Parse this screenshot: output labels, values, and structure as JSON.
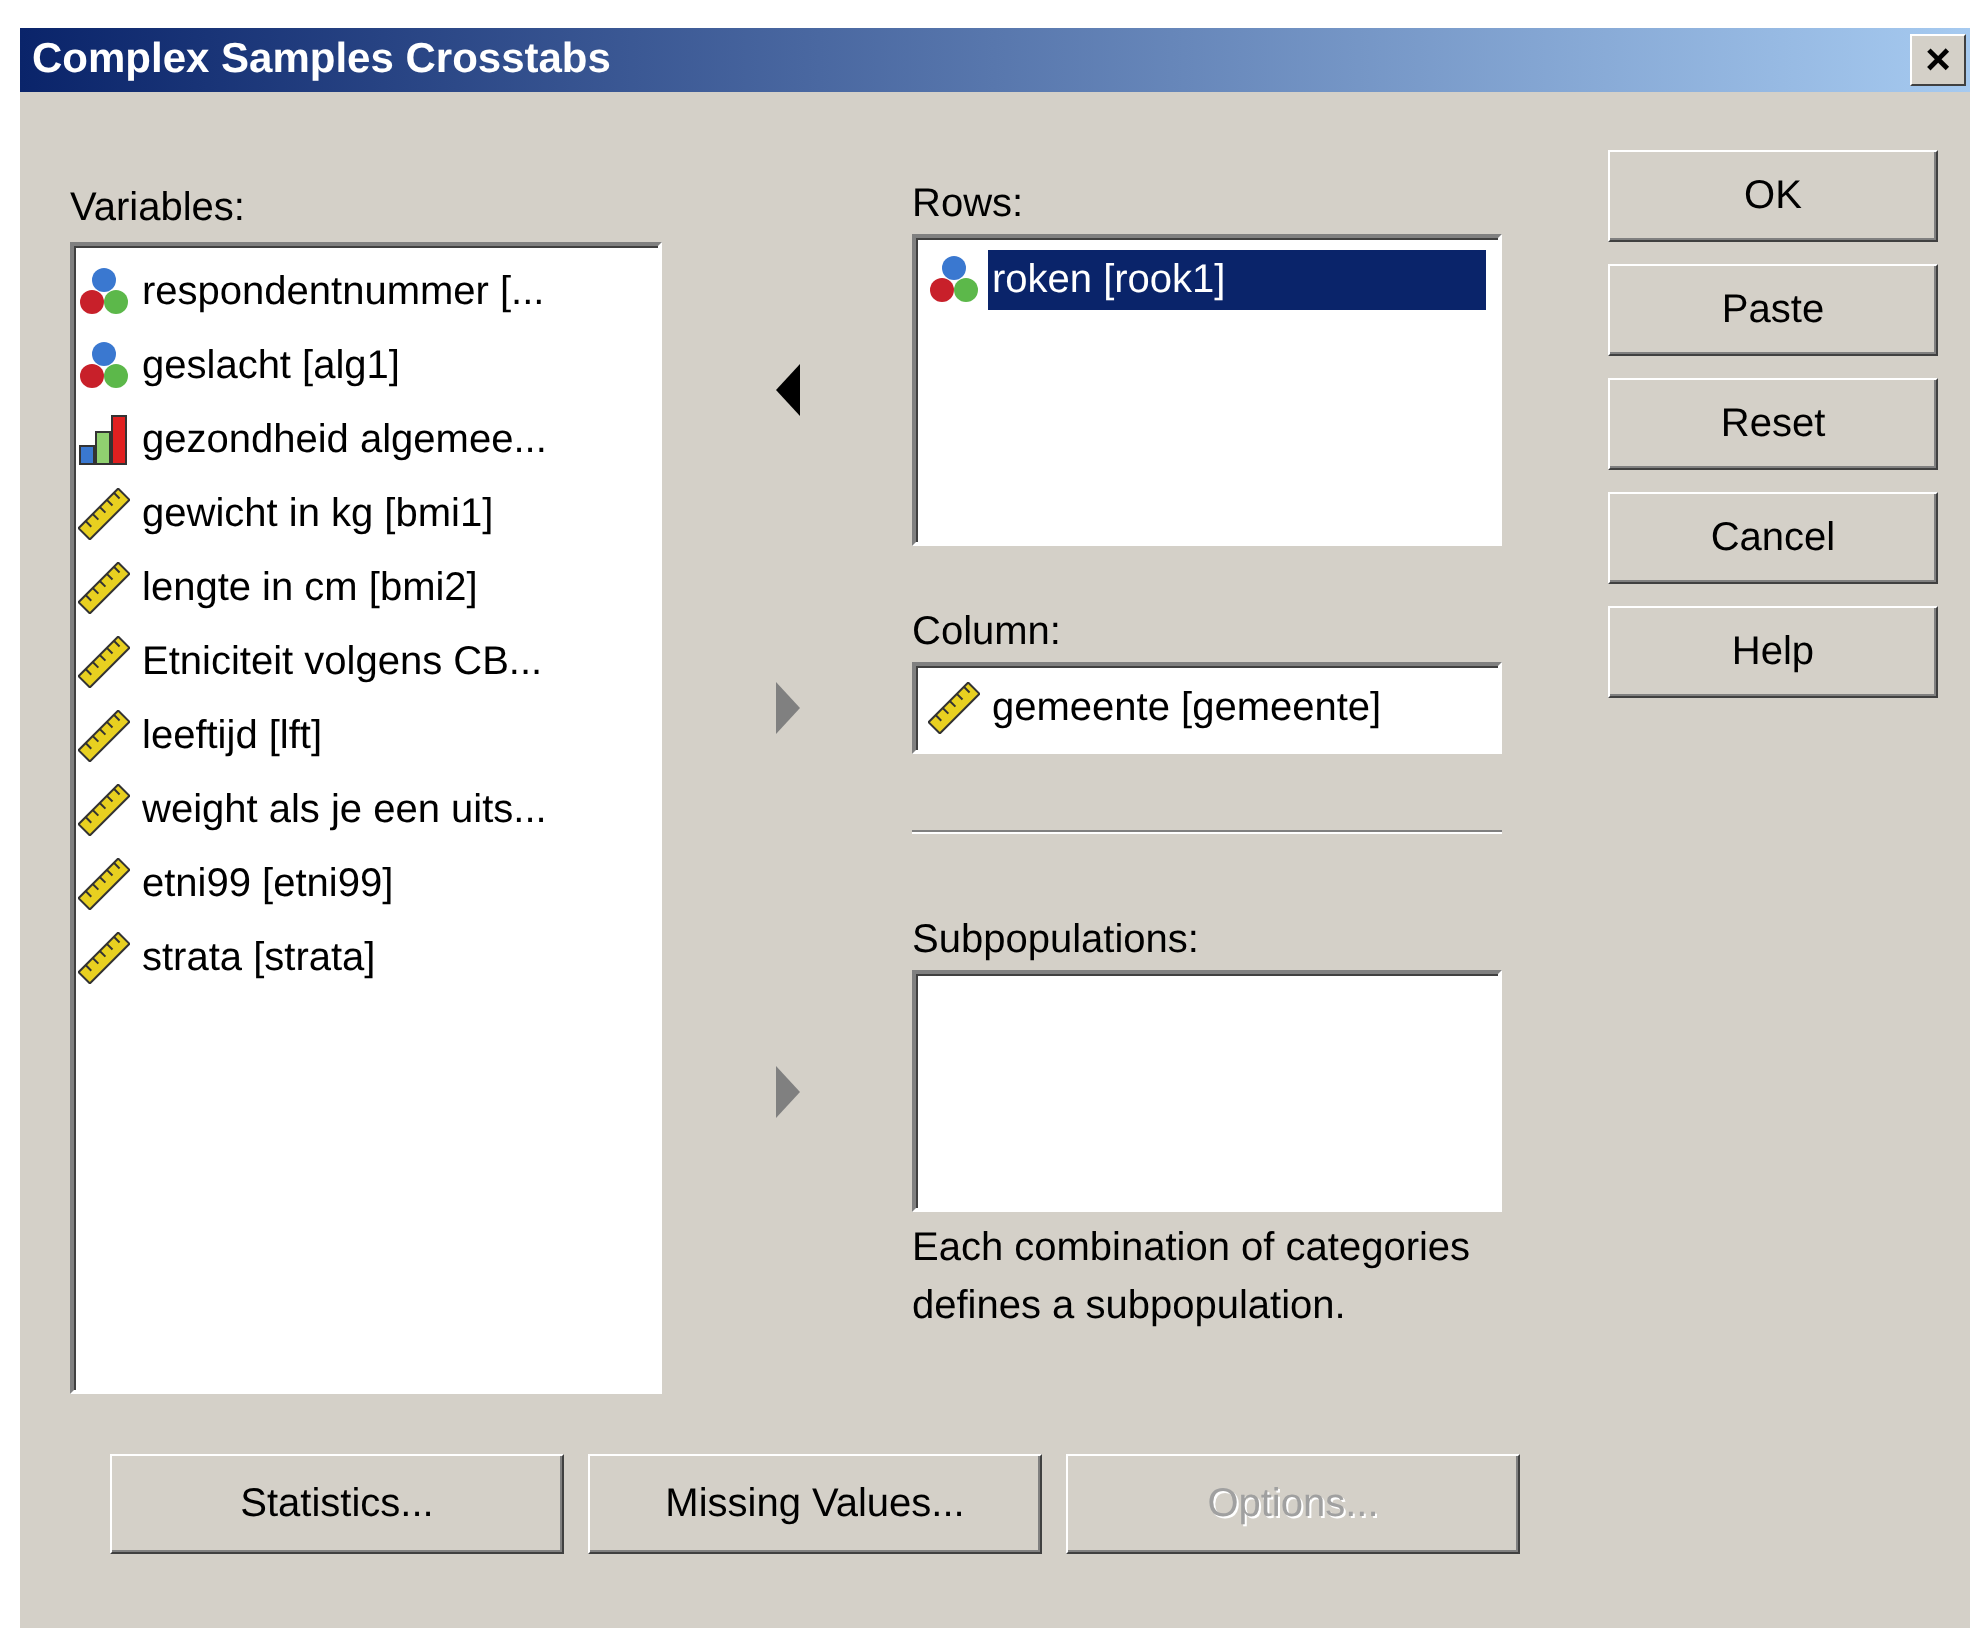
{
  "window": {
    "title": "Complex Samples Crosstabs",
    "close": "×"
  },
  "variables": {
    "label": "Variables:",
    "items": [
      {
        "kind": "nominal",
        "text": "respondentnummer [..."
      },
      {
        "kind": "nominal",
        "text": "geslacht [alg1]"
      },
      {
        "kind": "ordinal",
        "text": "gezondheid algemee..."
      },
      {
        "kind": "scale",
        "text": "gewicht in kg [bmi1]"
      },
      {
        "kind": "scale",
        "text": "lengte in cm [bmi2]"
      },
      {
        "kind": "scale",
        "text": "Etniciteit volgens CB..."
      },
      {
        "kind": "scale",
        "text": "leeftijd [lft]"
      },
      {
        "kind": "scale",
        "text": "weight als je een uits..."
      },
      {
        "kind": "scale",
        "text": "etni99 [etni99]"
      },
      {
        "kind": "scale",
        "text": "strata [strata]"
      }
    ]
  },
  "targets": [
    {
      "kind": "list",
      "label": "Rows:",
      "points_left": true,
      "disabled": false,
      "items": [
        {
          "kind": "nominal",
          "text": "roken [rook1]",
          "selected": true
        }
      ]
    },
    {
      "kind": "field",
      "label": "Column:",
      "points_left": false,
      "disabled": true,
      "items": [
        {
          "kind": "scale",
          "text": "gemeente [gemeente]",
          "selected": false
        }
      ]
    },
    {
      "kind": "list",
      "label": "Subpopulations:",
      "points_left": false,
      "disabled": true,
      "note": "Each combination of categories defines a subpopulation."
    }
  ],
  "side_buttons": [
    {
      "label": "OK",
      "disabled": false
    },
    {
      "label": "Paste",
      "disabled": false
    },
    {
      "label": "Reset",
      "disabled": false
    },
    {
      "label": "Cancel",
      "disabled": false
    },
    {
      "label": "Help",
      "disabled": false
    }
  ],
  "bottom_buttons": [
    {
      "label": "Statistics...",
      "disabled": false
    },
    {
      "label": "Missing Values...",
      "disabled": false
    },
    {
      "label": "Options...",
      "disabled": true
    }
  ]
}
